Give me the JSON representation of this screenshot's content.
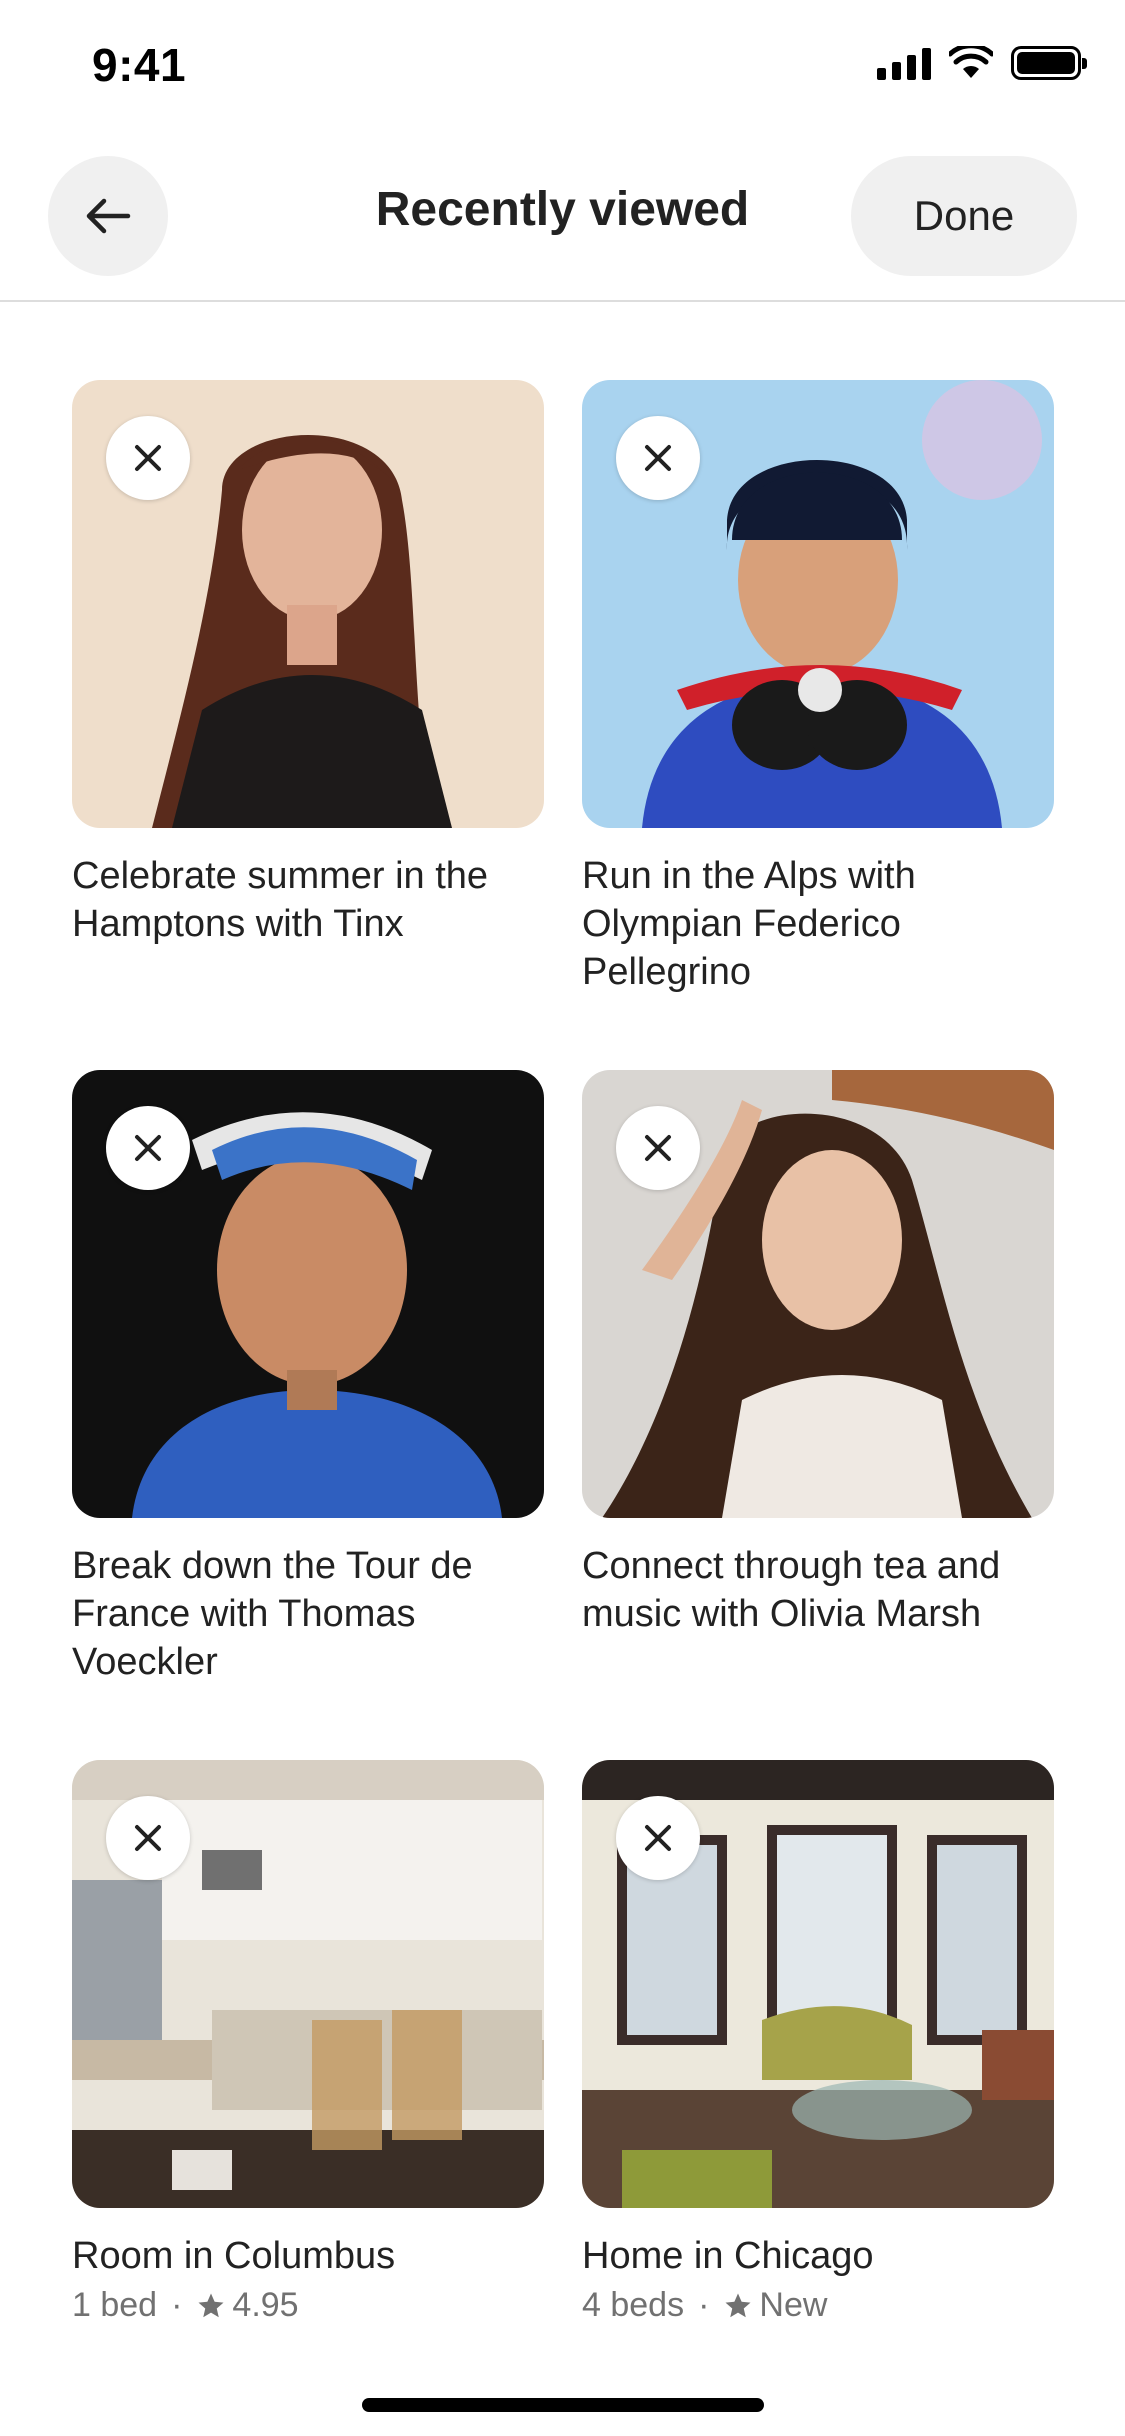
{
  "status_bar": {
    "time": "9:41"
  },
  "header": {
    "title": "Recently viewed",
    "done_label": "Done"
  },
  "items": [
    {
      "title": "Celebrate summer in the Hamptons with Tinx"
    },
    {
      "title": "Run in the Alps with Olympian Federico Pellegrino"
    },
    {
      "title": "Break down the Tour de France with Thomas Voeckler"
    },
    {
      "title": "Connect through tea and music with Olivia Marsh"
    },
    {
      "title": "Room in Columbus",
      "details": "1 bed",
      "rating": "4.95"
    },
    {
      "title": "Home in Chicago",
      "details": "4 beds",
      "rating": "New"
    }
  ],
  "icons": {
    "back": "arrow-left-icon",
    "remove": "close-icon",
    "rating": "star-icon"
  },
  "colors": {
    "text": "#222222",
    "muted": "#717171",
    "chip": "#f0f0f0"
  }
}
